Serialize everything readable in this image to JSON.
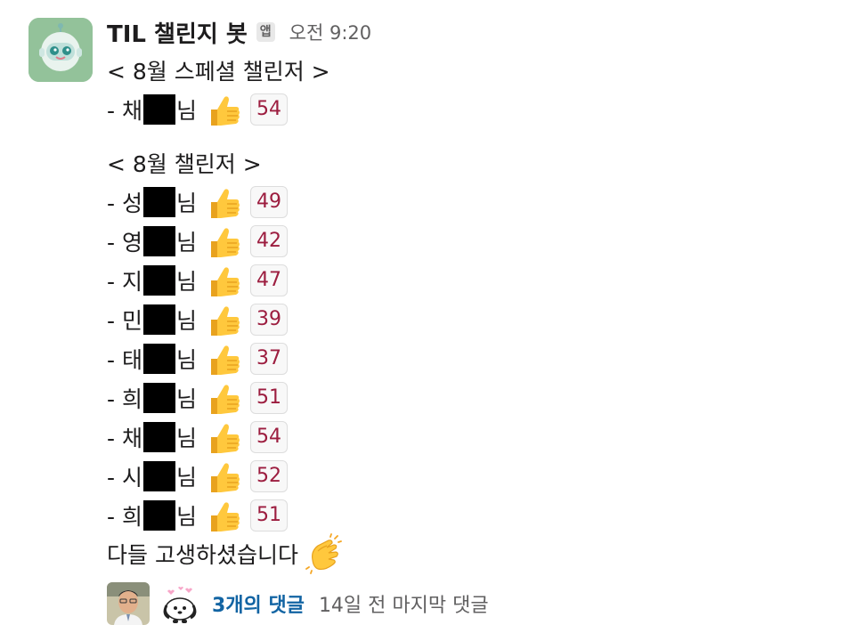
{
  "message": {
    "bot_name": "TIL 챌린지 봇",
    "app_badge": "앱",
    "time": "오전 9:20",
    "special_heading": "< 8월 스페셜 챌린저 >",
    "special_rows": [
      {
        "prefix": "- 채",
        "suffix": "님",
        "count": "54"
      }
    ],
    "regular_heading": "< 8월 챌린저 >",
    "regular_rows": [
      {
        "prefix": "- 성",
        "suffix": "님",
        "count": "49"
      },
      {
        "prefix": "- 영",
        "suffix": "님",
        "count": "42"
      },
      {
        "prefix": "- 지",
        "suffix": "님",
        "count": "47"
      },
      {
        "prefix": "- 민",
        "suffix": "님",
        "count": "39"
      },
      {
        "prefix": "- 태",
        "suffix": "님",
        "count": "37"
      },
      {
        "prefix": "- 희",
        "suffix": "님",
        "count": "51"
      },
      {
        "prefix": "- 채",
        "suffix": "님",
        "count": "54"
      },
      {
        "prefix": "- 시",
        "suffix": "님",
        "count": "52"
      },
      {
        "prefix": "- 희",
        "suffix": "님",
        "count": "51"
      }
    ],
    "closing": "다들 고생하셨습니다"
  },
  "thread": {
    "replies_label": "3개의 댓글",
    "last_reply": "14일 전 마지막 댓글"
  },
  "icons": {
    "avatar": "robot-avatar-icon",
    "row_emoji": "thumbs-up-icon",
    "closing_emoji": "clapping-hands-icon"
  },
  "colors": {
    "count_text": "#9c1d3f",
    "link": "#1264a3",
    "muted": "#616061"
  }
}
